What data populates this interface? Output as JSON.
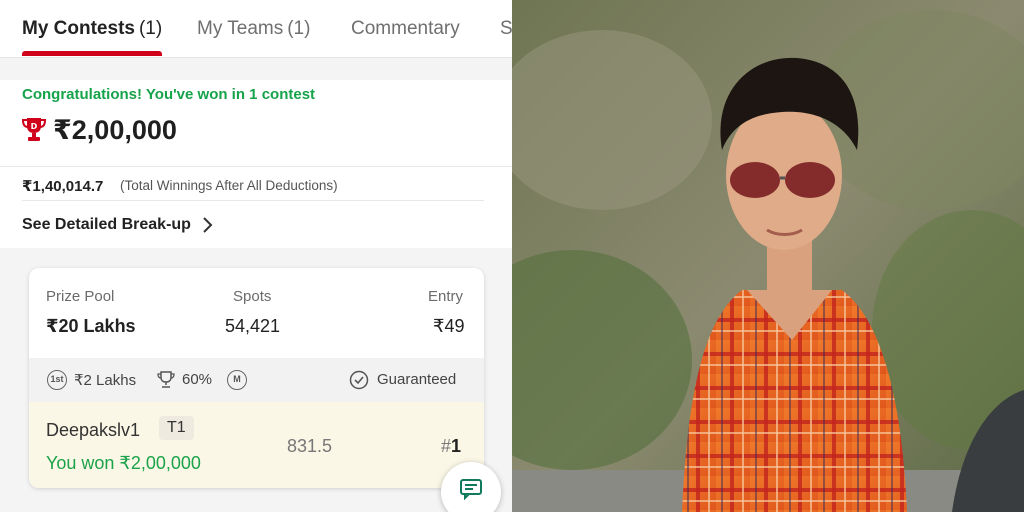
{
  "tabs": [
    {
      "label": "My Contests",
      "count": "(1)"
    },
    {
      "label": "My Teams",
      "count": "(1)"
    },
    {
      "label": "Commentary",
      "count": ""
    },
    {
      "label": "S",
      "count": ""
    }
  ],
  "winnings": {
    "congrats": "Congratulations! You've won in 1 contest",
    "amount": "₹2,00,000",
    "net_amount": "₹1,40,014.7",
    "net_note": "(Total Winnings After All Deductions)",
    "breakup_link": "See Detailed Break-up"
  },
  "contest": {
    "prize_pool_label": "Prize Pool",
    "prize_pool": "₹20 Lakhs",
    "spots_label": "Spots",
    "spots": "54,421",
    "entry_label": "Entry",
    "entry": "₹49",
    "first_prize_badge": "1st",
    "first_prize": "₹2 Lakhs",
    "winners_pct": "60%",
    "multi_badge": "M",
    "guaranteed": "Guaranteed"
  },
  "team": {
    "username": "Deepakslv1",
    "team_tag": "T1",
    "points": "831.5",
    "rank_prefix": "#",
    "rank": "1",
    "won_text": "You won ₹2,00,000"
  },
  "icons": {
    "trophy": "trophy-icon",
    "chevron": "chevron-right-icon",
    "cup": "cup-icon",
    "check": "check-circle-icon",
    "chat": "chat-icon"
  },
  "colors": {
    "accent_red": "#d0021b",
    "success_green": "#16a34a"
  }
}
